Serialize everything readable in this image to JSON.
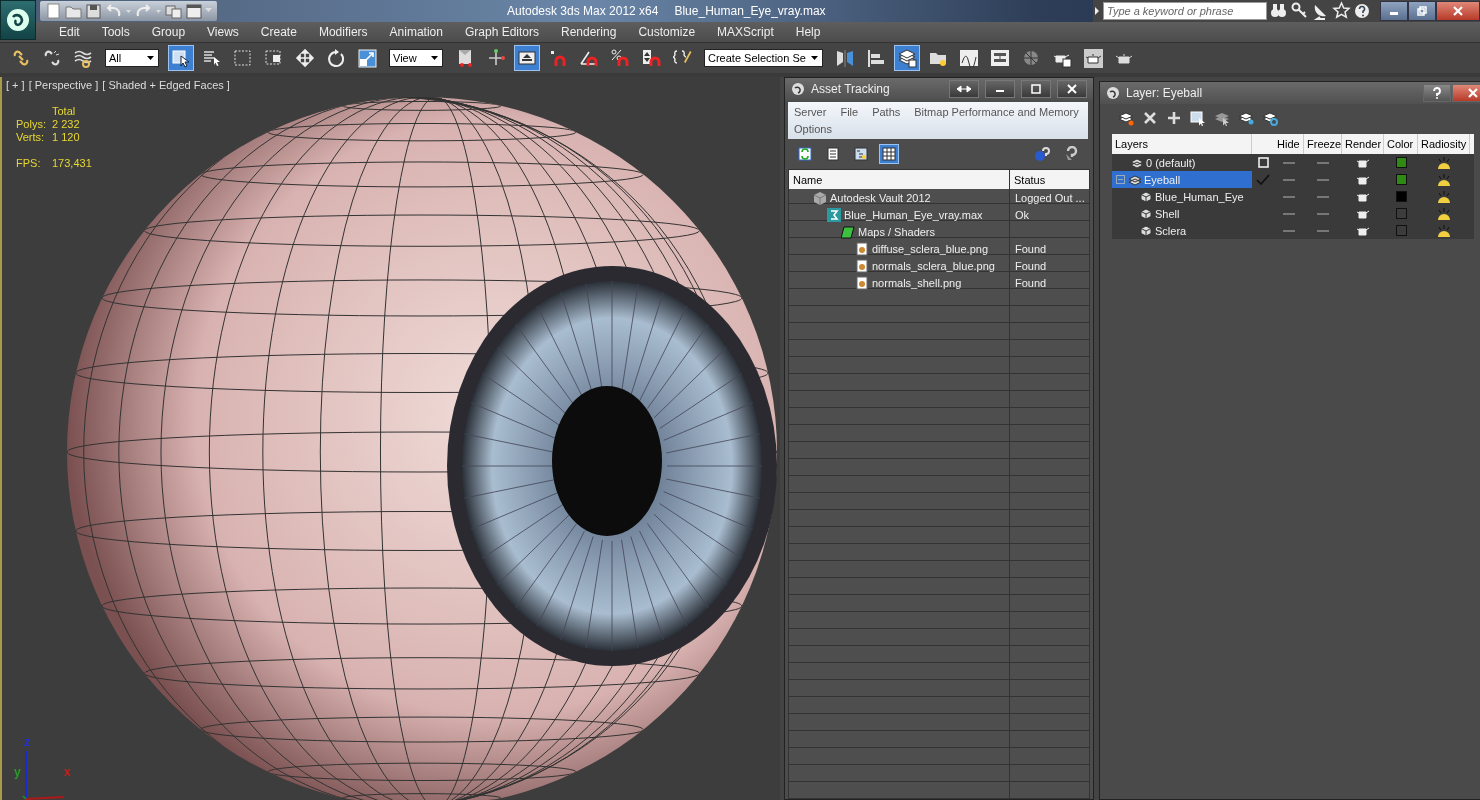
{
  "title_bar": {
    "app_title": "Autodesk 3ds Max  2012 x64",
    "file_name": "Blue_Human_Eye_vray.max",
    "search": {
      "placeholder": "Type a keyword or phrase"
    }
  },
  "menu_bar": [
    "Edit",
    "Tools",
    "Group",
    "Views",
    "Create",
    "Modifiers",
    "Animation",
    "Graph Editors",
    "Rendering",
    "Customize",
    "MAXScript",
    "Help"
  ],
  "toolbar": {
    "items": [
      {
        "kind": "button",
        "pressed": false
      },
      {
        "kind": "button",
        "pressed": false
      },
      {
        "kind": "button",
        "pressed": false
      },
      {
        "kind": "dropdown",
        "value": "All"
      },
      {
        "kind": "button",
        "pressed": true
      },
      {
        "kind": "button",
        "pressed": false
      },
      {
        "kind": "button",
        "pressed": false
      },
      {
        "kind": "button",
        "pressed": false
      },
      {
        "kind": "button",
        "pressed": false
      },
      {
        "kind": "button",
        "pressed": false
      },
      {
        "kind": "button",
        "pressed": false
      },
      {
        "kind": "dropdown",
        "value": "View"
      },
      {
        "kind": "button",
        "pressed": false
      },
      {
        "kind": "button",
        "pressed": false
      },
      {
        "kind": "button",
        "pressed": true
      },
      {
        "kind": "button",
        "pressed": false
      },
      {
        "kind": "button",
        "pressed": false
      },
      {
        "kind": "button",
        "pressed": false
      },
      {
        "kind": "button",
        "pressed": false
      },
      {
        "kind": "button",
        "pressed": false
      },
      {
        "kind": "dropdown",
        "value": "Create Selection Se"
      },
      {
        "kind": "button",
        "pressed": false
      },
      {
        "kind": "button",
        "pressed": false
      },
      {
        "kind": "button",
        "pressed": true
      },
      {
        "kind": "button",
        "pressed": false
      },
      {
        "kind": "button",
        "pressed": false
      },
      {
        "kind": "button",
        "pressed": false
      },
      {
        "kind": "button",
        "pressed": false
      },
      {
        "kind": "button",
        "pressed": false
      },
      {
        "kind": "button",
        "pressed": false
      },
      {
        "kind": "button",
        "pressed": false
      }
    ]
  },
  "viewport": {
    "labels": [
      "[ + ]",
      "[ Perspective ]",
      "[ Shaded + Edged Faces ]"
    ],
    "stats": {
      "header": "Total",
      "rows": [
        {
          "label": "Polys:",
          "value": "2 232"
        },
        {
          "label": "Verts:",
          "value": "1 120"
        },
        {
          "label": "FPS:",
          "value": "173,431"
        }
      ]
    },
    "axes": [
      "x",
      "y",
      "z"
    ]
  },
  "asset_tracking": {
    "title": "Asset Tracking",
    "menu": [
      "Server",
      "File",
      "Paths",
      "Bitmap Performance and Memory",
      "Options"
    ],
    "tools": [
      {
        "pressed": false
      },
      {
        "pressed": false
      },
      {
        "pressed": false
      },
      {
        "pressed": true
      }
    ],
    "columns": [
      "Name",
      "Status"
    ],
    "rows": [
      {
        "kind": "vault",
        "name": "Autodesk Vault 2012",
        "status": "Logged Out ...",
        "children": [
          {
            "kind": "scene",
            "name": "Blue_Human_Eye_vray.max",
            "status": "Ok",
            "children": [
              {
                "kind": "folder",
                "name": "Maps / Shaders",
                "children": [
                  {
                    "kind": "bitmap",
                    "name": "diffuse_sclera_blue.png",
                    "status": "Found"
                  },
                  {
                    "kind": "bitmap",
                    "name": "normals_sclera_blue.png",
                    "status": "Found"
                  },
                  {
                    "kind": "bitmap",
                    "name": "normals_shell.png",
                    "status": "Found"
                  }
                ]
              }
            ]
          }
        ]
      }
    ]
  },
  "layer_manager": {
    "title": "Layer: Eyeball",
    "columns": [
      "Layers",
      "Hide",
      "Freeze",
      "Render",
      "Color",
      "Radiosity"
    ],
    "layers": [
      {
        "kind": "layer",
        "name": "0 (default)",
        "selected": false,
        "current": false,
        "hidden": false,
        "frozen": false,
        "renderable": true,
        "color": "#2e8a12"
      },
      {
        "kind": "layer",
        "name": "Eyeball",
        "selected": true,
        "current": true,
        "expanded": true,
        "hidden": false,
        "frozen": false,
        "renderable": true,
        "color": "#2e8a12",
        "children": [
          {
            "kind": "object",
            "name": "Blue_Human_Eye",
            "selected": false,
            "hidden": false,
            "frozen": false,
            "renderable": true,
            "color": "#000000"
          },
          {
            "kind": "object",
            "name": "Shell",
            "selected": false,
            "hidden": false,
            "frozen": false,
            "renderable": true,
            "color": "#3c3c3c"
          },
          {
            "kind": "object",
            "name": "Sclera",
            "selected": false,
            "hidden": false,
            "frozen": false,
            "renderable": true,
            "color": "#3c3c3c"
          }
        ]
      }
    ]
  }
}
